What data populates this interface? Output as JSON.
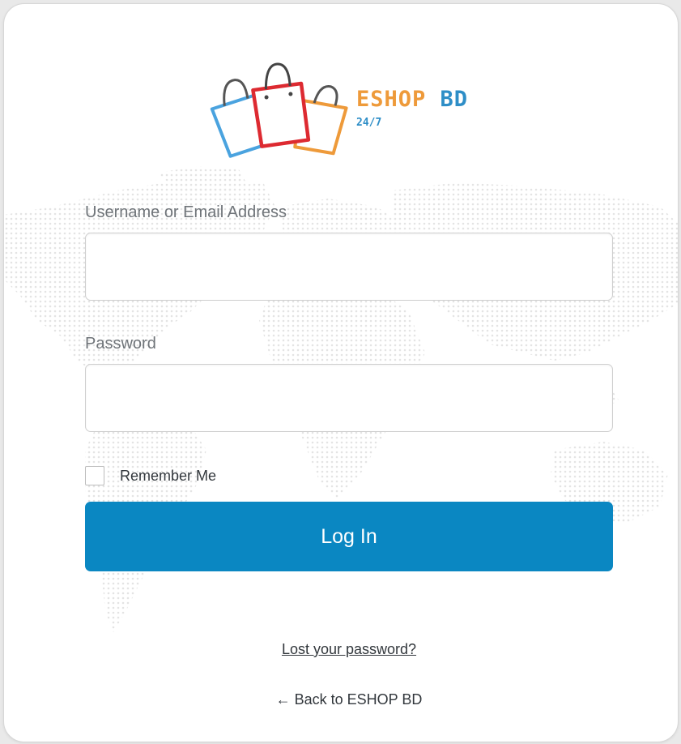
{
  "logo": {
    "brand": "ESHOP",
    "brand_suffix": "BD",
    "tagline": "24/7",
    "colors": {
      "blue": "#4aa3df",
      "red": "#dd2a31",
      "orange": "#ee9a3a"
    }
  },
  "form": {
    "username_label": "Username or Email Address",
    "username_value": "",
    "password_label": "Password",
    "password_value": "",
    "remember_label": "Remember Me",
    "remember_checked": false,
    "submit_label": "Log In"
  },
  "links": {
    "lost_password": "Lost your password?",
    "back_to_site": "← Back to ESHOP BD"
  },
  "colors": {
    "primary": "#0a87c2",
    "text": "#32373c",
    "label": "#6f7479"
  }
}
